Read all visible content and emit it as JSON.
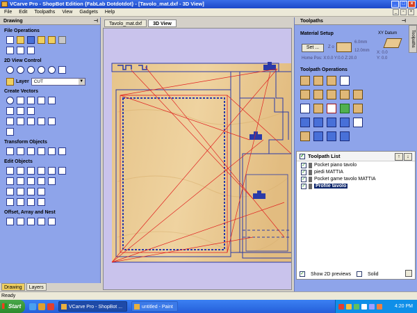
{
  "window": {
    "title": "VCarve Pro - ShopBot Edition {FabLab Dotdotdot} - [Tavolo_mat.dxf - 3D View]",
    "buttons": [
      "_",
      "□",
      "×"
    ]
  },
  "menu": [
    "File",
    "Edit",
    "Toolpaths",
    "View",
    "Gadgets",
    "Help"
  ],
  "left_panel": {
    "title": "Drawing",
    "sections": [
      {
        "title": "File Operations"
      },
      {
        "title": "2D View Control"
      },
      {
        "title": "Create Vectors"
      },
      {
        "title": "Transform Objects"
      },
      {
        "title": "Edit Objects"
      },
      {
        "title": "Offset, Array and Nest"
      }
    ],
    "layer_label": "Layer",
    "layer_value": "CUT",
    "bottom_tabs": [
      "Drawing",
      "Layers"
    ]
  },
  "doc_tabs": [
    "Tavolo_mat.dxf",
    "3D View"
  ],
  "right_panel": {
    "title": "Toolpaths",
    "side_tab": "Toolpaths",
    "material_setup_label": "Material Setup",
    "set_button": "Set ...",
    "dim_top": "6.0mm",
    "dim_bottom": "12.0mm",
    "z_label": "Z o",
    "xy_datum": "XY Datum",
    "xy_values": "X: 0.0",
    "xy_values2": "Y: 0.0",
    "home_pos": "Home Pos:   X:0.0 Y:0.0 Z:20.0",
    "toolpath_ops_label": "Toolpath Operations",
    "toolpath_list_label": "Toolpath List",
    "toolpaths": [
      {
        "label": "Pocket piano tavolo",
        "checked": true,
        "selected": false
      },
      {
        "label": "piedi MATTIA",
        "checked": true,
        "selected": false
      },
      {
        "label": "Pocket game tavolo MATTIA",
        "checked": true,
        "selected": false
      },
      {
        "label": "Profile tavolo",
        "checked": true,
        "selected": true
      }
    ],
    "show_2d_previews": "Show 2D previews",
    "solid": "Solid"
  },
  "status": "Ready",
  "taskbar": {
    "start": "Start",
    "items": [
      {
        "label": "VCarve Pro - ShopBot ...",
        "active": true
      },
      {
        "label": "untitled - Paint",
        "active": false
      }
    ],
    "clock": "4:20 PM"
  },
  "colors": {
    "panel_bg": "#8ea4ea",
    "view_bg": "#c9c3ec",
    "wood": "#e8c890",
    "vector_blue": "#2a3aa8",
    "toolpath_red": "#e02020"
  }
}
